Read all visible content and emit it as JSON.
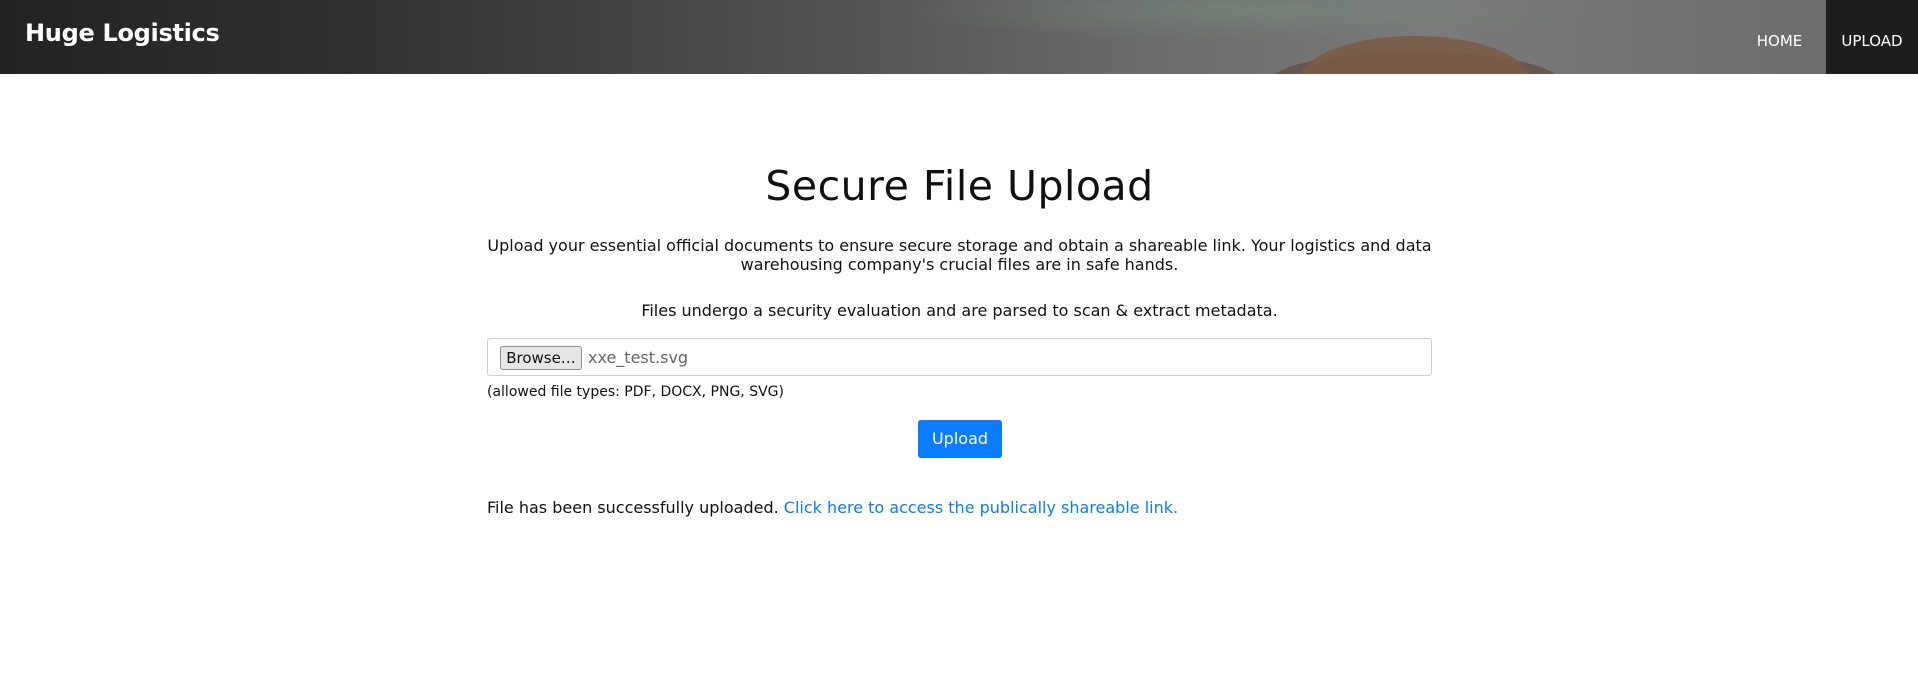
{
  "header": {
    "brand": "Huge Logistics",
    "nav": [
      {
        "label": "HOME",
        "active": false
      },
      {
        "label": "UPLOAD",
        "active": true
      }
    ],
    "active_color": "#1e1e1e"
  },
  "main": {
    "title": "Secure File Upload",
    "description": "Upload your essential official documents to ensure secure storage and obtain a shareable link. Your logistics and data warehousing company's crucial files are in safe hands.",
    "security_note": "Files undergo a security evaluation and are parsed to scan & extract metadata.",
    "file_input": {
      "browse_label": "Browse…",
      "selected_file": "xxe_test.svg"
    },
    "allowed_types": "(allowed file types: PDF, DOCX, PNG, SVG)",
    "upload_button": "Upload",
    "status_text": "File has been successfully uploaded.",
    "status_link": "Click here to access the publically shareable link.",
    "accent_color": "#0a7cff"
  }
}
